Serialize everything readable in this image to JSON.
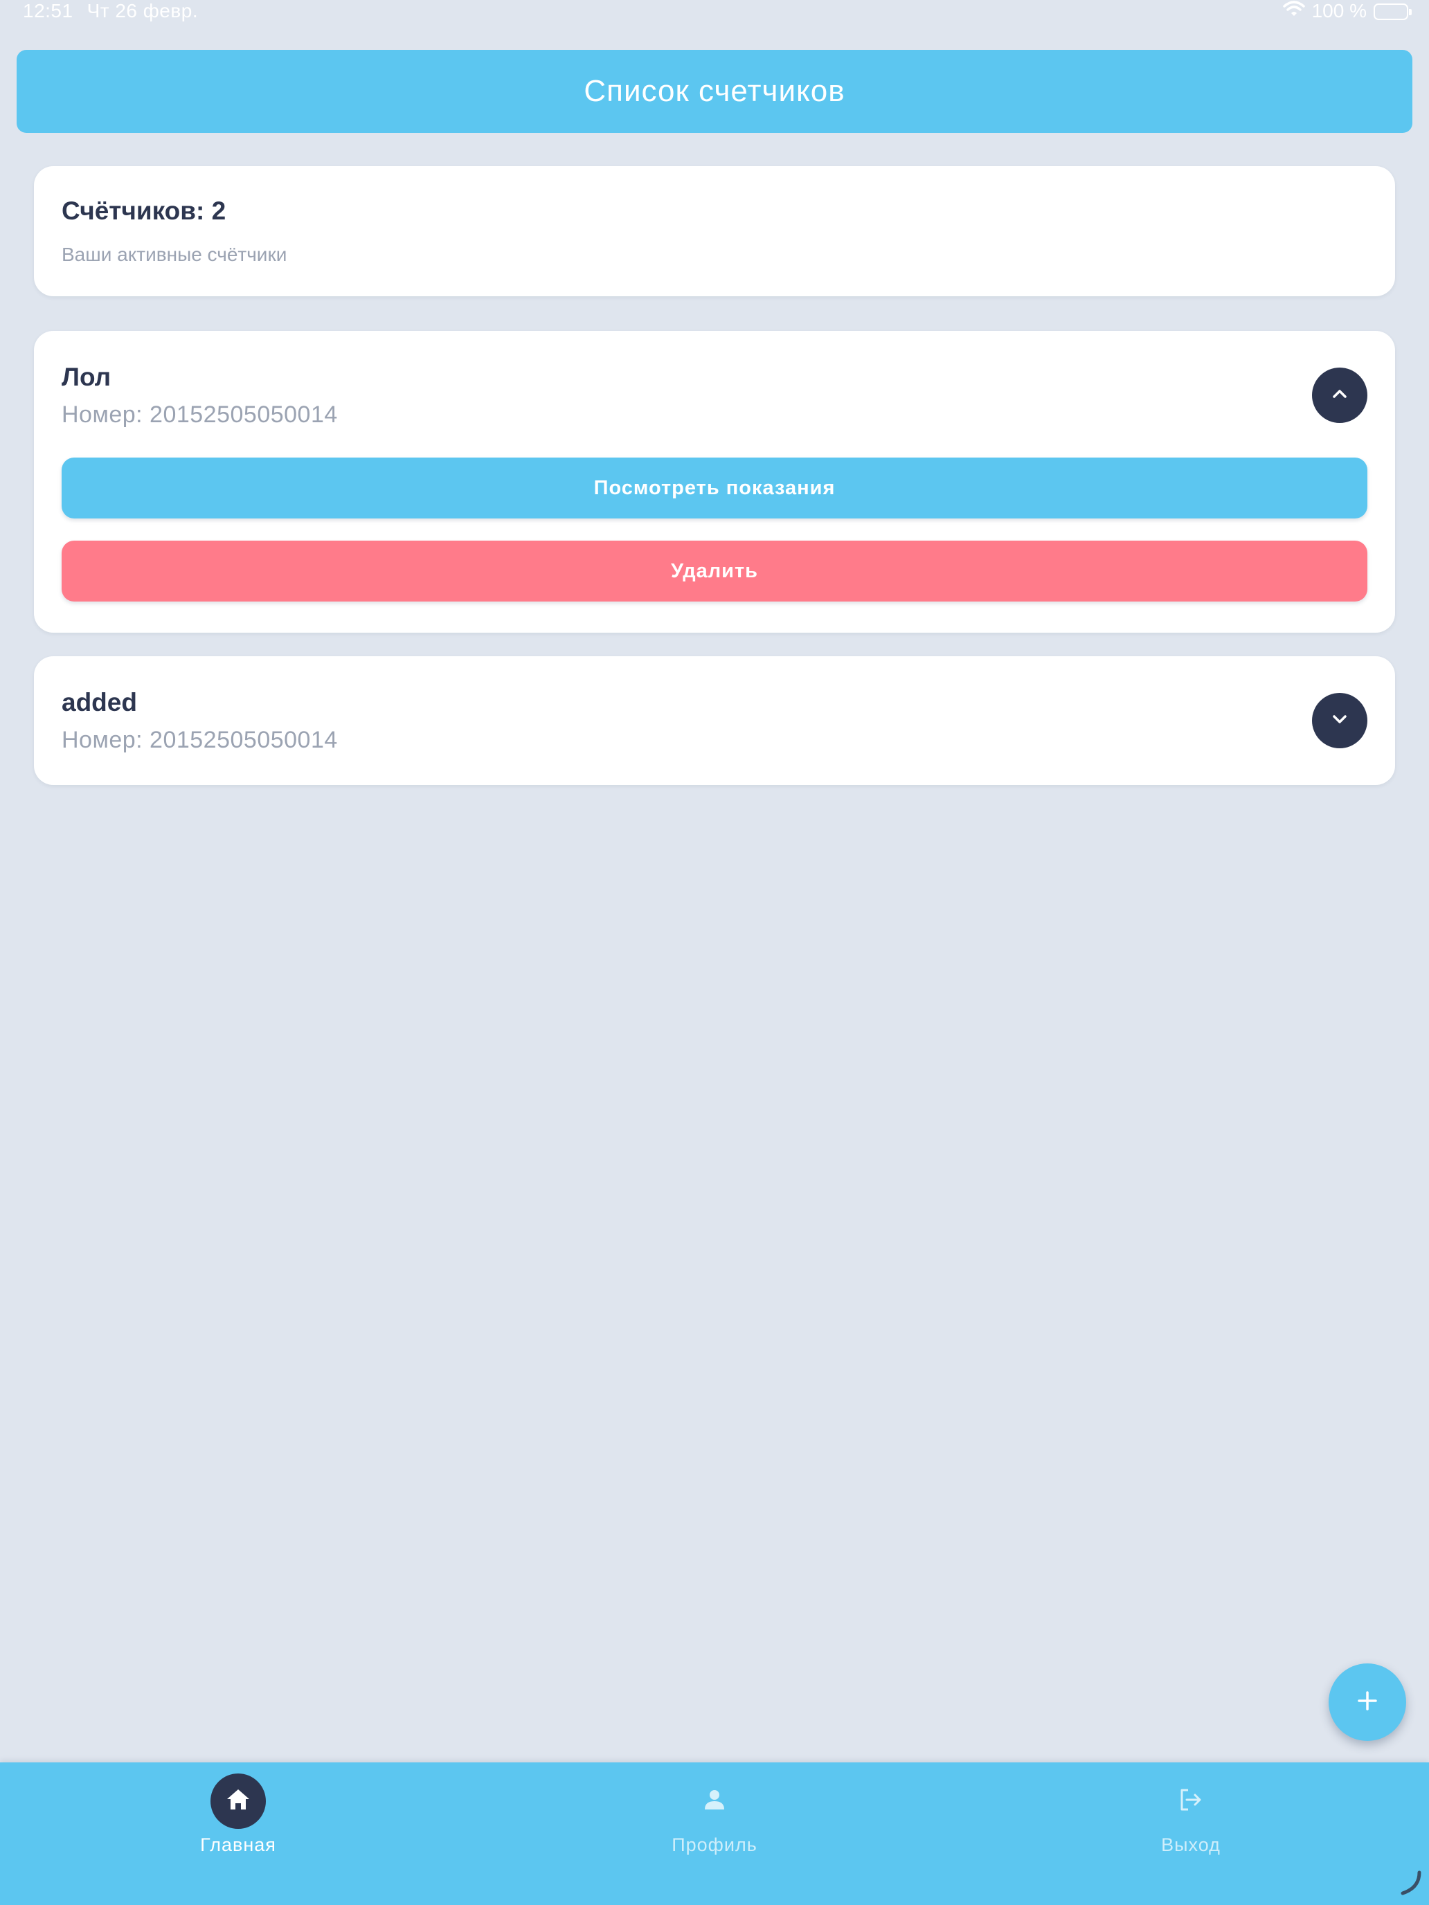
{
  "status_bar": {
    "time": "12:51",
    "date": "Чт 26 февр.",
    "battery": "100 %"
  },
  "header": {
    "title": "Список счетчиков"
  },
  "summary": {
    "title": "Счётчиков: 2",
    "subtitle": "Ваши активные счётчики"
  },
  "meters": [
    {
      "name": "Лол",
      "number": "Номер: 20152505050014",
      "expanded": true,
      "view_label": "Посмотреть показания",
      "delete_label": "Удалить"
    },
    {
      "name": "added",
      "number": "Номер: 20152505050014",
      "expanded": false
    }
  ],
  "nav": {
    "home": "Главная",
    "profile": "Профиль",
    "logout": "Выход"
  },
  "colors": {
    "background": "#dfe5ee",
    "accent": "#5cc6f0",
    "danger": "#ff7b8a",
    "dark": "#2d3650",
    "muted_text": "#9ba3b2"
  },
  "icons": {
    "wifi": "wifi-icon",
    "battery": "battery-icon",
    "collapse": "chevron-up-icon",
    "expand": "chevron-down-icon",
    "add": "plus-icon",
    "home": "home-icon",
    "profile": "person-icon",
    "logout": "logout-icon"
  }
}
